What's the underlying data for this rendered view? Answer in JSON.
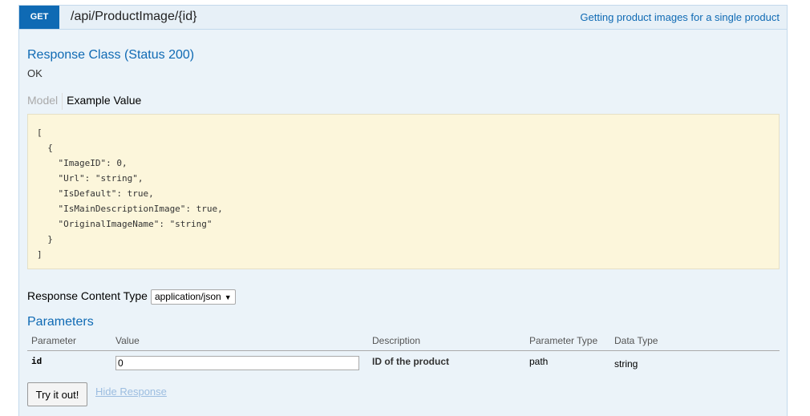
{
  "operation": {
    "method": "GET",
    "path": "/api/ProductImage/{id}",
    "summary": "Getting product images for a single product"
  },
  "response_class": {
    "title": "Response Class (Status 200)",
    "status_text": "OK"
  },
  "tabs": {
    "model": "Model",
    "example": "Example Value"
  },
  "example_value": "[\n  {\n    \"ImageID\": 0,\n    \"Url\": \"string\",\n    \"IsDefault\": true,\n    \"IsMainDescriptionImage\": true,\n    \"OriginalImageName\": \"string\"\n  }\n]",
  "content_type": {
    "label": "Response Content Type",
    "selected": "application/json"
  },
  "parameters": {
    "title": "Parameters",
    "columns": [
      "Parameter",
      "Value",
      "Description",
      "Parameter Type",
      "Data Type"
    ],
    "rows": [
      {
        "name": "id",
        "value": "0",
        "description": "ID of the product",
        "param_type": "path",
        "data_type": "string"
      }
    ]
  },
  "actions": {
    "try_label": "Try it out!",
    "hide_label": "Hide Response"
  },
  "colors": {
    "accent": "#0f6ab4",
    "panel_bg": "#ebf3f9",
    "example_bg": "#fcf6db"
  }
}
